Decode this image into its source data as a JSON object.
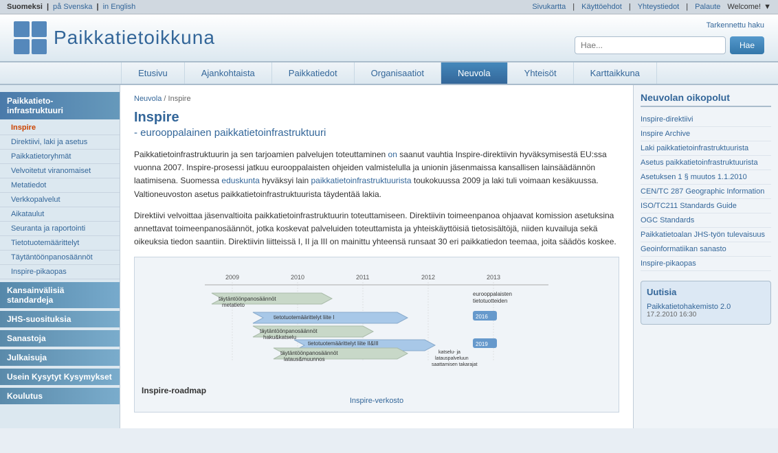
{
  "topbar": {
    "lang_fi": "Suomeksi",
    "lang_sv": "på Svenska",
    "lang_en": "in English",
    "nav_links": [
      "Sivukartta",
      "Käyttöehdot",
      "Yhteystiedot",
      "Palaute"
    ],
    "welcome": "Welcome!"
  },
  "header": {
    "logo_text": "Paikkatietoikkuna",
    "search_placeholder": "Hae...",
    "search_button": "Hae",
    "advanced_search": "Tarkennettu haku"
  },
  "main_nav": {
    "items": [
      {
        "label": "Etusivu",
        "active": false
      },
      {
        "label": "Ajankohtaista",
        "active": false
      },
      {
        "label": "Paikkatiedot",
        "active": false
      },
      {
        "label": "Organisaatiot",
        "active": false
      },
      {
        "label": "Neuvola",
        "active": true
      },
      {
        "label": "Yhteisöt",
        "active": false
      },
      {
        "label": "Karttaikkuna",
        "active": false
      }
    ]
  },
  "sidebar": {
    "sections": [
      {
        "title": "Paikkatieto-infrastruktuuri",
        "active": false,
        "items": [
          {
            "label": "Inspire",
            "active": true
          },
          {
            "label": "Direktiivi, laki ja asetus",
            "active": false
          },
          {
            "label": "Paikkatietoryhmät",
            "active": false
          },
          {
            "label": "Velvoitetut viranomaiset",
            "active": false
          },
          {
            "label": "Metatiedot",
            "active": false
          },
          {
            "label": "Verkkopalvelut",
            "active": false
          },
          {
            "label": "Aikataulut",
            "active": false
          },
          {
            "label": "Seuranta ja raportointi",
            "active": false
          },
          {
            "label": "Tietotuotemäärittelyt",
            "active": false
          },
          {
            "label": "Täytäntöönpanosäännöt",
            "active": false
          },
          {
            "label": "Inspire-pikaopas",
            "active": false
          }
        ]
      },
      {
        "title": "Kansainvälisiä standardeja",
        "active": false,
        "items": []
      },
      {
        "title": "JHS-suosituksia",
        "active": false,
        "items": []
      },
      {
        "title": "Sanastoja",
        "active": false,
        "items": []
      },
      {
        "title": "Julkaisuja",
        "active": false,
        "items": []
      },
      {
        "title": "Usein Kysytyt Kysymykset",
        "active": false,
        "items": []
      },
      {
        "title": "Koulutus",
        "active": false,
        "items": []
      }
    ]
  },
  "main": {
    "breadcrumb": "Neuvola / Inspire",
    "breadcrumb_parent": "Neuvola",
    "heading": "Inspire",
    "subheading": "- eurooppalainen paikkatietoinfrastruktuuri",
    "para1": "Paikkatietoinfrastruktuurin ja sen tarjoamien palvelujen toteuttaminen on saanut vauhtia Inspire-direktiivin hyväksymisestä EU:ssa vuonna 2007. Inspire-prosessi jatkuu eurooppalaisten ohjeiden valmistelulla ja unionin jäsenmaissa kansallisen lainsäädännön laatimisena. Suomessa eduskunta hyväksyi lain paikkatietoinfrastruktuurista toukokuussa 2009 ja laki tuli voimaan kesäkuussa. Valtioneuvoston asetus paikkatietoinfrastruktuurista täydentää lakia.",
    "para2": "Direktiivi velvoittaa jäsenvaltioita paikkatietoinfrastruktuurin toteuttamiseen. Direktiivin toimeenpanoa ohjaavat komission asetuksina annettavat toimeenpanosäännöt, jotka koskevat palveluiden toteuttamista ja yhteiskäyttöisiä tietosisältöjä, niiden kuvailuja sekä oikeuksia tiedon saantiin. Direktiivin liitteissä I, II ja III on mainittu yhteensä runsaat 30 eri paikkatiedon teemaa, joita säädös koskee.",
    "roadmap_title": "Inspire-roadmap",
    "roadmap_subtitle": "Inspire-verkosto"
  },
  "right_sidebar": {
    "title": "Neuvolan oikopolut",
    "links": [
      "Inspire-direktiivi",
      "Inspire Archive",
      "Laki paikkatietoinfrastruktuurista",
      "Asetus paikkatietoinfrastruktuurista",
      "Asetuksen 1 § muutos 1.1.2010",
      "CEN/TC 287 Geographic Information",
      "ISO/TC211 Standards Guide",
      "OGC Standards",
      "Paikkatietoalan JHS-työn tulevaisuus",
      "Geoinformatiikan sanasto",
      "Inspire-pikaopas"
    ],
    "news_title": "Uutisia",
    "news_items": [
      {
        "title": "Paikkatietohakemisto 2.0",
        "date": "17.2.2010 16:30"
      }
    ]
  }
}
